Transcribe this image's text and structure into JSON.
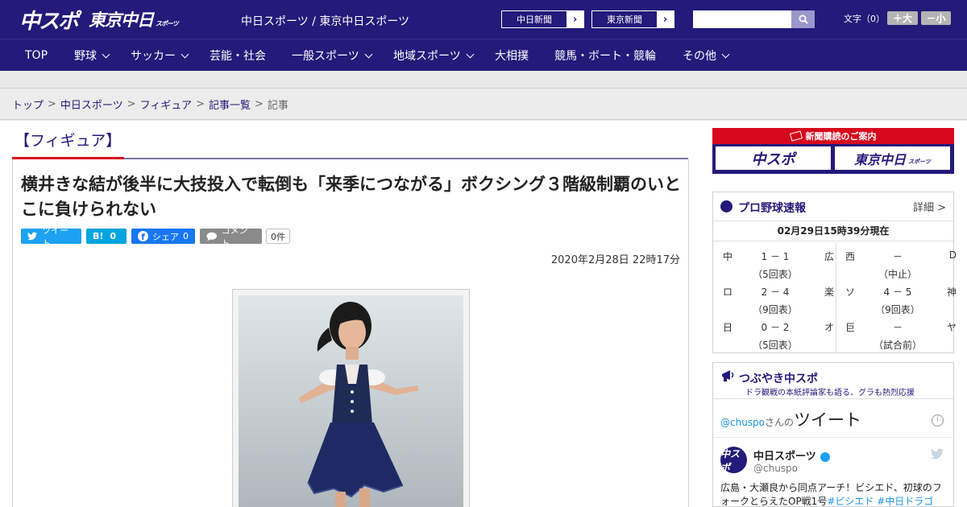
{
  "header": {
    "logo_chuspo": "中スポ",
    "logo_tochu": "東京中日",
    "logo_tochu_small": "スポーツ",
    "site_title": "中日スポーツ / 東京中日スポーツ",
    "paper_buttons": [
      {
        "label": "中日新聞",
        "arrow": "›"
      },
      {
        "label": "東京新聞",
        "arrow": "›"
      }
    ],
    "search": {
      "placeholder": "",
      "icon": "search-icon"
    },
    "font_label": "文字（0）",
    "font_up": "＋大",
    "font_down": "－小"
  },
  "nav": [
    {
      "label": "TOP",
      "dropdown": false
    },
    {
      "label": "野球",
      "dropdown": true
    },
    {
      "label": "サッカー",
      "dropdown": true
    },
    {
      "label": "芸能・社会",
      "dropdown": false
    },
    {
      "label": "一般スポーツ",
      "dropdown": true
    },
    {
      "label": "地域スポーツ",
      "dropdown": true
    },
    {
      "label": "大相撲",
      "dropdown": false
    },
    {
      "label": "競馬・ボート・競輪",
      "dropdown": false
    },
    {
      "label": "その他",
      "dropdown": true
    }
  ],
  "breadcrumb": {
    "items": [
      "トップ",
      "中日スポーツ",
      "フィギュア",
      "記事一覧"
    ],
    "separator": ">",
    "current": "記事"
  },
  "article": {
    "section": "【フィギュア】",
    "headline": "横井きな結が後半に大技投入で転倒も「来季につながる」ボクシング３階級制覇のいとこに負けられない",
    "share": {
      "tweet": "ツイート",
      "hatena_icon": "B!",
      "hatena_count": "0",
      "facebook": "シェア",
      "facebook_count": "0",
      "comment": "コメント",
      "comment_count": "0件"
    },
    "date": "2020年2月28日 22時17分"
  },
  "sidebar": {
    "subscription": {
      "title": "新聞購読のご案内",
      "chuspo": "中スポ",
      "tochu": "東京中日",
      "tochu_small": "スポーツ"
    },
    "baseball": {
      "title": "プロ野球速報",
      "detail": "詳細 >",
      "updated": "02月29日15時39分現在",
      "games": [
        {
          "home": "中",
          "score": "1 － 1",
          "away": "広",
          "status": "（5回表）"
        },
        {
          "home": "西",
          "score": "－",
          "away": "D",
          "status": "（中止）"
        },
        {
          "home": "ロ",
          "score": "2 － 4",
          "away": "楽",
          "status": "（9回表）"
        },
        {
          "home": "ソ",
          "score": "4 － 5",
          "away": "神",
          "status": "（9回表）"
        },
        {
          "home": "日",
          "score": "0 － 2",
          "away": "オ",
          "status": "（5回表）"
        },
        {
          "home": "巨",
          "score": "－",
          "away": "ヤ",
          "status": "（試合前）"
        }
      ]
    },
    "tsubuyaki": {
      "title": "つぶやき中スポ",
      "subtitle": "ドラ観戦の本紙評論家も語る、グラも熱烈応援",
      "tweets_handle": "@chuspo",
      "tweets_suffix": "さんの",
      "tweets_word": "ツイート",
      "info": "i",
      "avatar_text": "中スポ",
      "name": "中日スポーツ",
      "user": "@chuspo",
      "text_main": "広島・大瀬良から同点アーチ！ビシエド、初球のフォークとらえたOP戦1号",
      "text_tags": "#ビシエド #中日ドラゴ"
    }
  },
  "colors": {
    "brand_navy": "#231a7a",
    "accent_red": "#d7081d",
    "twitter_blue": "#1da1f2",
    "facebook_blue": "#1877f2",
    "hatena_blue": "#00a4de"
  }
}
